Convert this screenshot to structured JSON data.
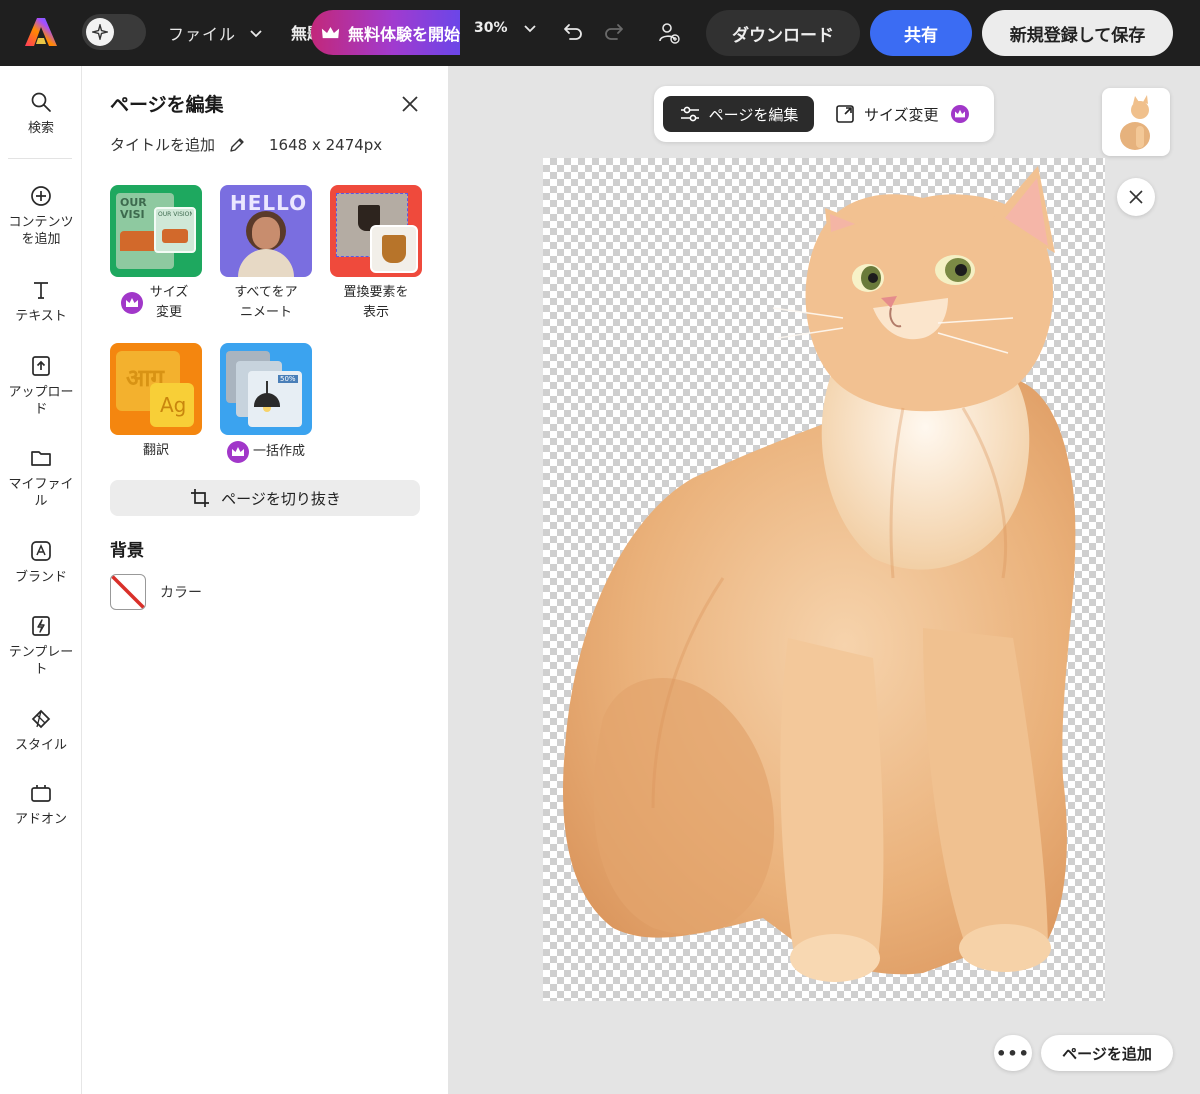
{
  "topbar": {
    "file_menu_label": "ファイル",
    "doc_title_truncated": "無題",
    "trial_label": "無料体験を開始",
    "zoom_value": "30%",
    "download_label": "ダウンロード",
    "share_label": "共有",
    "save_label": "新規登録して保存",
    "colors": {
      "bar": "#1f1f1f",
      "share": "#3b6cf3",
      "trial_gradient": [
        "#c2287a",
        "#6b46e8"
      ]
    }
  },
  "rail": {
    "items": [
      {
        "label": "検索",
        "icon": "search-icon"
      },
      {
        "label": "コンテンツを追加",
        "icon": "plus-circle-icon"
      },
      {
        "label": "テキスト",
        "icon": "text-icon"
      },
      {
        "label": "アップロード",
        "icon": "upload-icon"
      },
      {
        "label": "マイファイル",
        "icon": "folder-icon"
      },
      {
        "label": "ブランド",
        "icon": "brand-icon"
      },
      {
        "label": "テンプレート",
        "icon": "template-icon"
      },
      {
        "label": "スタイル",
        "icon": "style-icon"
      },
      {
        "label": "アドオン",
        "icon": "addon-icon"
      }
    ]
  },
  "panel": {
    "title": "ページを編集",
    "add_title_label": "タイトルを追加",
    "dimensions": "1648 x 2474px",
    "tools": [
      {
        "label": "サイズ変更",
        "premium": true
      },
      {
        "label": "すべてをアニメート",
        "premium": false
      },
      {
        "label": "置換要素を表示",
        "premium": false
      },
      {
        "label": "翻訳",
        "premium": false
      },
      {
        "label": "一括作成",
        "premium": true
      }
    ],
    "tile_texts": {
      "resize_big": "OUR VISI",
      "resize_small": "OUR VISION",
      "animate_banner": "HELLO",
      "translate_hindi": "आग",
      "translate_latin": "Ag",
      "bulk_badge": "50%"
    },
    "crop_label": "ページを切り抜き",
    "background_heading": "背景",
    "color_label": "カラー"
  },
  "canvas": {
    "toolbar": {
      "edit_label": "ページを編集",
      "resize_label": "サイズ変更"
    },
    "add_page_label": "ページを追加",
    "more_label": "•••"
  }
}
